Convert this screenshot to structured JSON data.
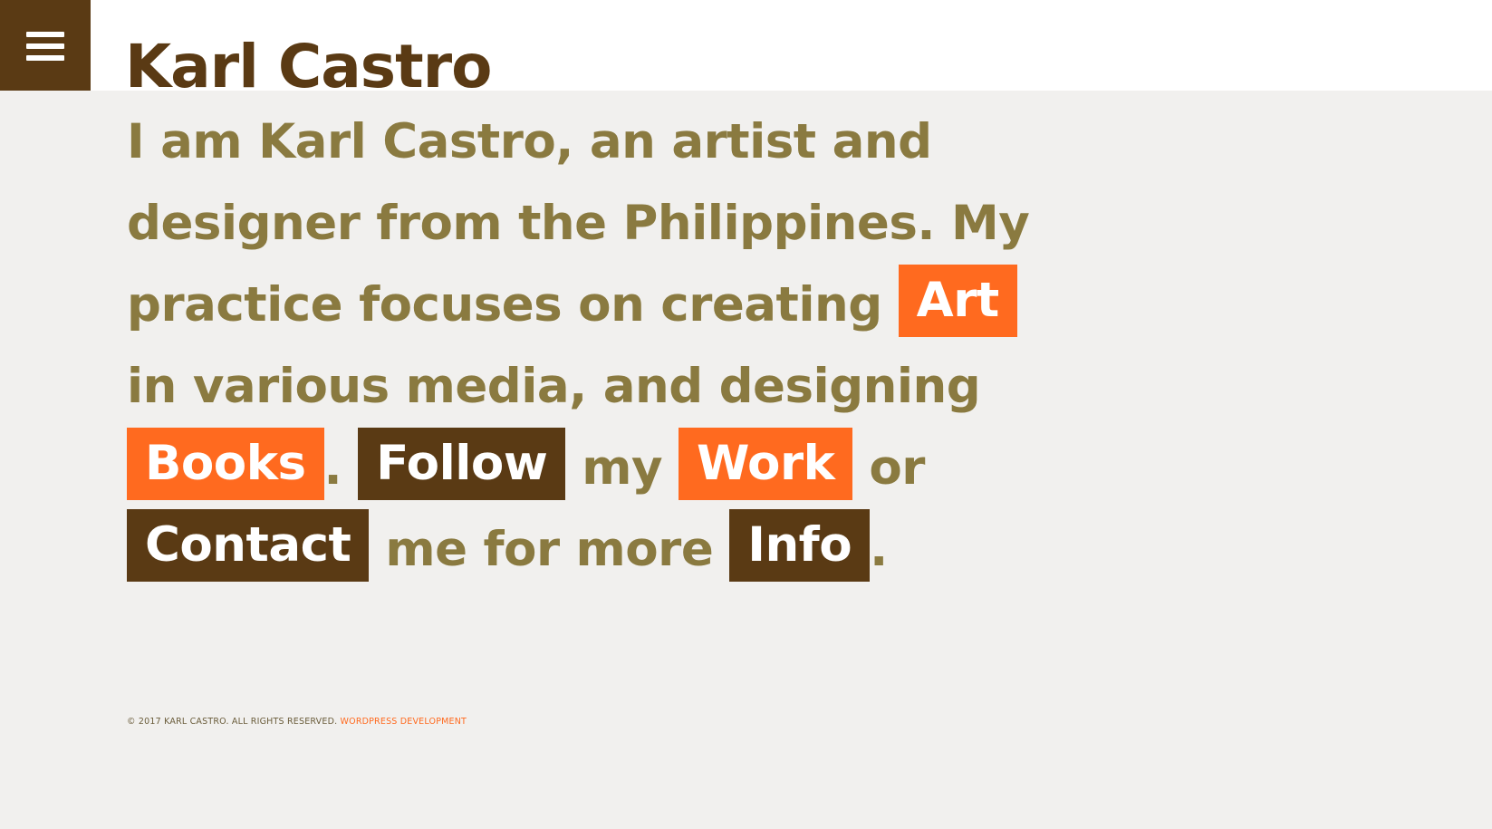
{
  "header": {
    "site_title": "Karl Castro",
    "menu_icon": "hamburger-menu-icon"
  },
  "intro": {
    "line1": "I am Karl Castro, an artist and",
    "line2": "designer from the Philippines. My",
    "line3_text": "practice focuses on creating",
    "art_link": "Art",
    "line4": "in various media, and designing",
    "books_link": "Books",
    "period1": ".",
    "follow_link": "Follow",
    "my_text": "my",
    "work_link": "Work",
    "or_text": "or",
    "contact_link": "Contact",
    "more_text": "me for more",
    "info_link": "Info",
    "period2": "."
  },
  "footer": {
    "copyright": "© 2017 KARL CASTRO. ALL RIGHTS RESERVED.",
    "dev_link": "WORDPRESS DEVELOPMENT"
  },
  "colors": {
    "brand_brown": "#5a3a14",
    "accent_orange": "#ff6a1f",
    "text_olive": "#8a7a40",
    "background": "#f1f0ee"
  }
}
